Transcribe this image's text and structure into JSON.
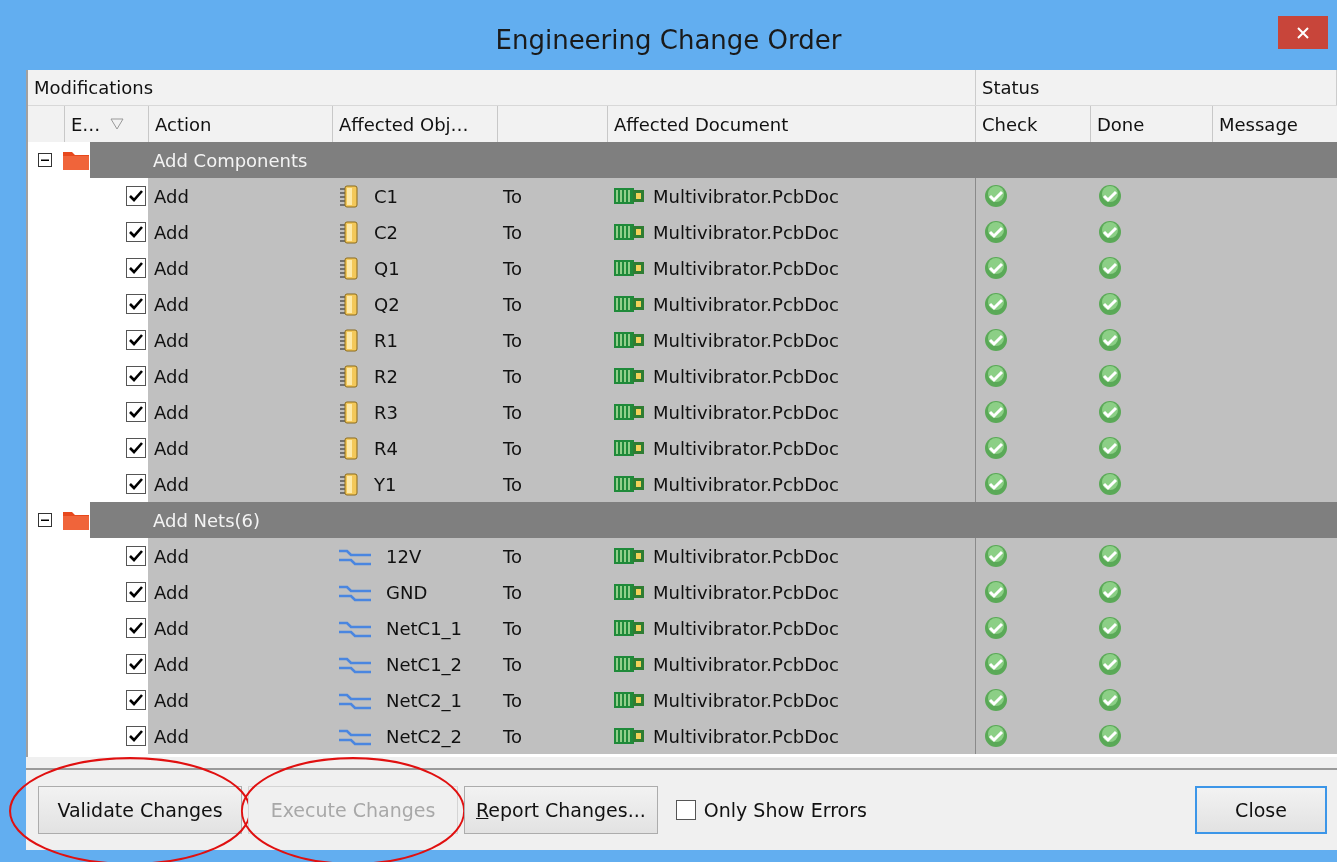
{
  "window": {
    "title": "Engineering Change Order"
  },
  "header_groups": [
    "Modifications",
    "Status"
  ],
  "columns": [
    {
      "label": "E…",
      "filter": true
    },
    {
      "label": "Action",
      "filter": false
    },
    {
      "label": "Affected Obj…",
      "filter": false
    },
    {
      "label": "Affected Document",
      "filter": false
    },
    {
      "label": "Check",
      "filter": false
    },
    {
      "label": "Done",
      "filter": false
    },
    {
      "label": "Message",
      "filter": false
    }
  ],
  "groups": [
    {
      "name": "Add Components",
      "expanded": true,
      "rows": [
        {
          "checked": true,
          "action": "Add",
          "object": "C1",
          "kind": "component",
          "to": "To",
          "document": "Multivibrator.PcbDoc",
          "check_ok": true,
          "done_ok": true
        },
        {
          "checked": true,
          "action": "Add",
          "object": "C2",
          "kind": "component",
          "to": "To",
          "document": "Multivibrator.PcbDoc",
          "check_ok": true,
          "done_ok": true
        },
        {
          "checked": true,
          "action": "Add",
          "object": "Q1",
          "kind": "component",
          "to": "To",
          "document": "Multivibrator.PcbDoc",
          "check_ok": true,
          "done_ok": true
        },
        {
          "checked": true,
          "action": "Add",
          "object": "Q2",
          "kind": "component",
          "to": "To",
          "document": "Multivibrator.PcbDoc",
          "check_ok": true,
          "done_ok": true
        },
        {
          "checked": true,
          "action": "Add",
          "object": "R1",
          "kind": "component",
          "to": "To",
          "document": "Multivibrator.PcbDoc",
          "check_ok": true,
          "done_ok": true
        },
        {
          "checked": true,
          "action": "Add",
          "object": "R2",
          "kind": "component",
          "to": "To",
          "document": "Multivibrator.PcbDoc",
          "check_ok": true,
          "done_ok": true
        },
        {
          "checked": true,
          "action": "Add",
          "object": "R3",
          "kind": "component",
          "to": "To",
          "document": "Multivibrator.PcbDoc",
          "check_ok": true,
          "done_ok": true
        },
        {
          "checked": true,
          "action": "Add",
          "object": "R4",
          "kind": "component",
          "to": "To",
          "document": "Multivibrator.PcbDoc",
          "check_ok": true,
          "done_ok": true
        },
        {
          "checked": true,
          "action": "Add",
          "object": "Y1",
          "kind": "component",
          "to": "To",
          "document": "Multivibrator.PcbDoc",
          "check_ok": true,
          "done_ok": true
        }
      ]
    },
    {
      "name": "Add Nets(6)",
      "expanded": true,
      "rows": [
        {
          "checked": true,
          "action": "Add",
          "object": "12V",
          "kind": "net",
          "to": "To",
          "document": "Multivibrator.PcbDoc",
          "check_ok": true,
          "done_ok": true
        },
        {
          "checked": true,
          "action": "Add",
          "object": "GND",
          "kind": "net",
          "to": "To",
          "document": "Multivibrator.PcbDoc",
          "check_ok": true,
          "done_ok": true
        },
        {
          "checked": true,
          "action": "Add",
          "object": "NetC1_1",
          "kind": "net",
          "to": "To",
          "document": "Multivibrator.PcbDoc",
          "check_ok": true,
          "done_ok": true
        },
        {
          "checked": true,
          "action": "Add",
          "object": "NetC1_2",
          "kind": "net",
          "to": "To",
          "document": "Multivibrator.PcbDoc",
          "check_ok": true,
          "done_ok": true
        },
        {
          "checked": true,
          "action": "Add",
          "object": "NetC2_1",
          "kind": "net",
          "to": "To",
          "document": "Multivibrator.PcbDoc",
          "check_ok": true,
          "done_ok": true
        },
        {
          "checked": true,
          "action": "Add",
          "object": "NetC2_2",
          "kind": "net",
          "to": "To",
          "document": "Multivibrator.PcbDoc",
          "check_ok": true,
          "done_ok": true
        }
      ]
    }
  ],
  "buttons": [
    {
      "label": "Validate Changes",
      "disabled": false,
      "circled": true,
      "mnemonic": false
    },
    {
      "label": "Execute Changes",
      "disabled": true,
      "circled": true,
      "mnemonic": false
    },
    {
      "label": "Report Changes...",
      "disabled": false,
      "circled": false,
      "mnemonic": true
    }
  ],
  "only_show_errors": {
    "label": "Only Show Errors",
    "checked": false
  },
  "close_button": {
    "label": "Close",
    "default": true
  }
}
